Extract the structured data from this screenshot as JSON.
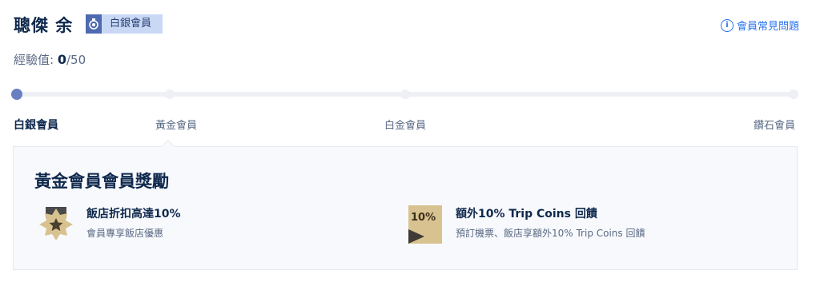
{
  "user": {
    "name": "聰傑 余"
  },
  "badge": {
    "label": "白銀會員",
    "icon": "medal-icon"
  },
  "faq": {
    "label": "會員常見問題",
    "icon": "info-icon"
  },
  "experience": {
    "label": "經驗值: ",
    "current": "0",
    "total": "/50"
  },
  "progress": {
    "fraction": 0.0
  },
  "tiers": [
    {
      "name": "白銀會員",
      "current": true
    },
    {
      "name": "黃金會員",
      "current": false
    },
    {
      "name": "白金會員",
      "current": false
    },
    {
      "name": "鑽石會員",
      "current": false
    }
  ],
  "rewards": {
    "title": "黃金會員會員獎勵",
    "items": [
      {
        "icon": "hotel-discount-star-icon",
        "title": "飯店折扣高達10%",
        "subtitle": "會員專享飯店優惠"
      },
      {
        "icon": "trip-coins-10-percent-icon",
        "icon_text": "10%",
        "title": "額外10% Trip Coins 回饋",
        "subtitle": "預訂機票、飯店享額外10% Trip Coins 回饋"
      }
    ]
  },
  "colors": {
    "accent": "#2872f0",
    "progress_dot": "#6a7fc1",
    "badge_bg": "#c9d9f5",
    "badge_icon_bg": "#4f6ab0",
    "gold": "#c9a96a"
  }
}
